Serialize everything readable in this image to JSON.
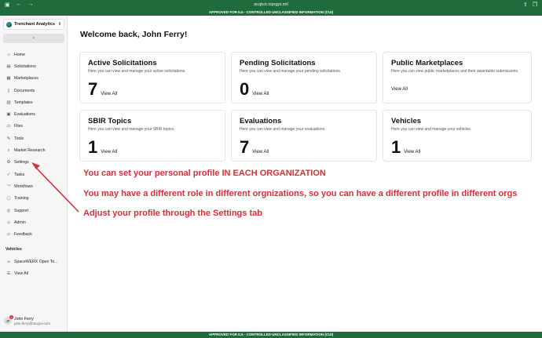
{
  "browser": {
    "url": "acqbot.niprgpt.mil"
  },
  "banner": {
    "top": "APPROVED FOR IL5 - CONTROLLED UNCLASSIFIED INFORMATION (CUI)",
    "bottom": "APPROVED FOR IL5 - CONTROLLED UNCLASSIFIED INFORMATION (CUI)"
  },
  "sidebar": {
    "org_name": "Trenchant Analytics",
    "collapse_glyph": "‹",
    "items": [
      {
        "label": "Home",
        "icon": "home-icon"
      },
      {
        "label": "Solicitations",
        "icon": "document-icon"
      },
      {
        "label": "Marketplaces",
        "icon": "store-icon"
      },
      {
        "label": "Documents",
        "icon": "file-icon"
      },
      {
        "label": "Templates",
        "icon": "template-icon"
      },
      {
        "label": "Evaluations",
        "icon": "clipboard-icon"
      },
      {
        "label": "Files",
        "icon": "folder-icon"
      },
      {
        "label": "Tools",
        "icon": "wrench-icon"
      },
      {
        "label": "Market Research",
        "icon": "search-icon"
      },
      {
        "label": "Settings",
        "icon": "gear-icon"
      },
      {
        "label": "Tasks",
        "icon": "check-icon"
      },
      {
        "label": "Workflows",
        "icon": "workflow-icon"
      },
      {
        "label": "Training",
        "icon": "book-icon"
      },
      {
        "label": "Support",
        "icon": "help-icon"
      },
      {
        "label": "Admin",
        "icon": "user-icon"
      },
      {
        "label": "Feedback",
        "icon": "chat-icon"
      }
    ],
    "vehicles_label": "Vehicles",
    "vehicles": [
      {
        "label": "SpaceWERX Open To..."
      },
      {
        "label": "View All"
      }
    ],
    "user": {
      "initials": "JF",
      "badge": "3",
      "name": "John Ferry",
      "email": "john.ferry@tacgov.com"
    }
  },
  "main": {
    "welcome": "Welcome back, John Ferry!",
    "cards": [
      {
        "title": "Active Solicitations",
        "desc": "Here you can view and manage your active solicitations.",
        "count": "7",
        "link": "View All"
      },
      {
        "title": "Pending Solicitations",
        "desc": "Here you can view and manage your pending solicitations.",
        "count": "0",
        "link": "View All"
      },
      {
        "title": "Public Marketplaces",
        "desc": "Here you can view public marketplaces and their awardable submissions.",
        "count": "",
        "link": "View All"
      },
      {
        "title": "SBIR Topics",
        "desc": "Here you can view and manage your SBIR topics.",
        "count": "1",
        "link": "View All"
      },
      {
        "title": "Evaluations",
        "desc": "Here you can view and manage your evaluations.",
        "count": "7",
        "link": "View All"
      },
      {
        "title": "Vehicles",
        "desc": "Here you can view and manage your vehicles.",
        "count": "1",
        "link": "View All"
      }
    ],
    "annotations": [
      "You can set your personal profile IN EACH ORGANIZATION",
      "You may have a different role in different orgnizations, so you can have a different profile in different orgs",
      "Adjust your profile through the Settings tab"
    ]
  },
  "colors": {
    "banner": "#1f6b3b",
    "annotation": "#d7303a"
  }
}
